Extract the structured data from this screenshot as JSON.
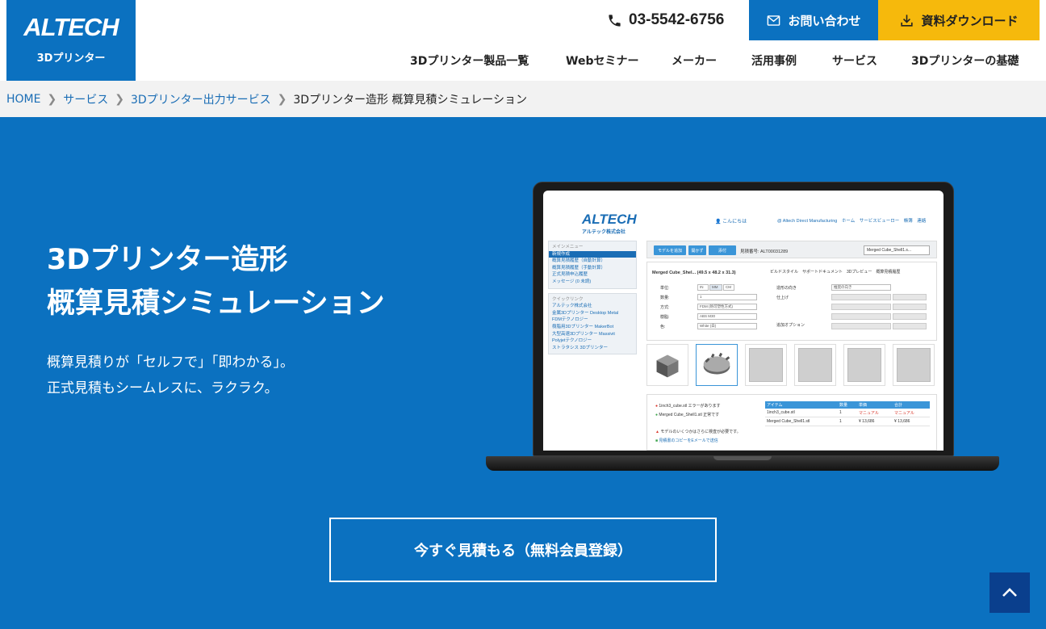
{
  "header": {
    "logo_text": "ALTECH",
    "logo_sub": "3Dプリンター",
    "phone": "03-5542-6756",
    "contact_label": "お問い合わせ",
    "download_label": "資料ダウンロード",
    "nav": [
      "3Dプリンター製品一覧",
      "Webセミナー",
      "メーカー",
      "活用事例",
      "サービス",
      "3Dプリンターの基礎"
    ]
  },
  "breadcrumb": {
    "items": [
      "HOME",
      "サービス",
      "3Dプリンター出力サービス"
    ],
    "current": "3Dプリンター造形 概算見積シミュレーション"
  },
  "hero": {
    "title_line1": "3Dプリンター造形",
    "title_line2": "概算見積シミュレーション",
    "lead_line1": "概算見積りが「セルフで」「即わかる」。",
    "lead_line2": "正式見積もシームレスに、ラクラク。",
    "cta_label": "今すぐ見積もる（無料会員登録）"
  },
  "colors": {
    "brand_blue": "#0b71c0",
    "download_yellow": "#f6b90c",
    "to_top_navy": "#0a3f8d"
  },
  "screen": {
    "logo": "ALTECH",
    "logo_sub": "アルテック株式会社",
    "user": "こんにちは",
    "topnav": "@ Altech Direct Manufacturing　ホーム　サービスビューロー　帳簿　連絡",
    "side_menu": [
      "メインメニュー",
      "新規作成",
      "概算見積履歴（自動計算）",
      "概算見積履歴（手動計算）",
      "正式見積申込履歴",
      "メッセージ (0 未読)"
    ],
    "side_links": [
      "クイックリンク",
      "アルテック株式会社",
      "金属3Dプリンター Desktop Metal",
      "FDMテクノロジー",
      "樹脂用3Dプリンター MakerBot",
      "大型高速3Dプリンター Massivit",
      "Polyjetテクノロジー",
      "ストラタシス 3Dプリンター"
    ],
    "toolbar_btns": [
      "モデルを追加",
      "開かず",
      "添付"
    ],
    "quote_no": "見積番号: ALT00031289",
    "model_select": "Merged Cube_Shell1.s...",
    "model_name": "Merged Cube_Shel... (49.5 x 48.2 x 31.3)",
    "panel_actions": "ビルドスタイル　サポートドキュメント　3Dプレビュー　概算見積履歴",
    "fields": [
      "単位:",
      "数量:",
      "方式:",
      "樹脂:",
      "色:"
    ],
    "field_values": [
      "1",
      "FDM (熱可塑性方式)",
      "ABS M30",
      "White (白)"
    ],
    "unit_options": [
      "IN",
      "MM",
      "CM"
    ],
    "right_fields": [
      "造形の向き",
      "仕上げ",
      "追加オプション"
    ],
    "orientation_value": "推奨の向き",
    "status_error": "1inch3_cube.stl エラーがあります",
    "status_ok": "Merged Cube_Shell1.stl 正常です",
    "status_warn": "モデルのいくつかはさらに検査が必要です。",
    "status_mail": "見積書のコピーをEメールで送信",
    "table_headers": [
      "アイテム",
      "数量",
      "単価",
      "合計"
    ],
    "table_rows": [
      [
        "1inch3_cube.stl",
        "1",
        "マニュアル",
        "マニュアル"
      ],
      [
        "Merged Cube_Shell1.stl",
        "1",
        "¥ 13,686",
        "¥ 13,686"
      ]
    ]
  }
}
